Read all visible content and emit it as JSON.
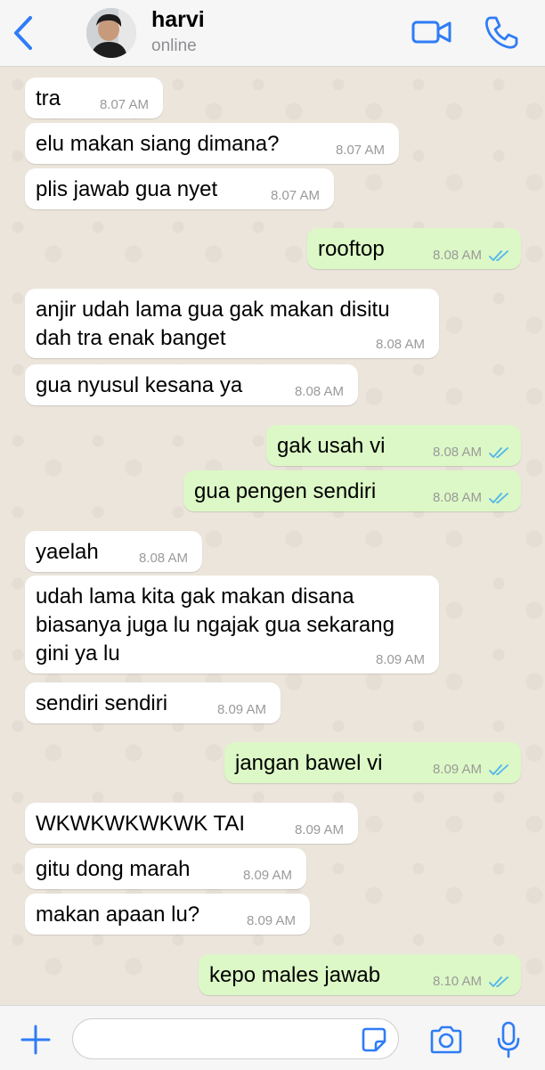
{
  "header": {
    "back_icon": "chevron-left-icon",
    "contact_name": "harvi",
    "contact_status": "online",
    "video_icon": "video-camera-icon",
    "call_icon": "phone-icon",
    "accent_color": "#2f7cf6"
  },
  "messages": [
    {
      "direction": "in",
      "text": "tra",
      "time": "8.07 AM"
    },
    {
      "direction": "in",
      "text": "elu makan siang dimana?",
      "time": "8.07 AM"
    },
    {
      "direction": "in",
      "text": "plis jawab gua nyet",
      "time": "8.07 AM"
    },
    {
      "direction": "out",
      "text": "rooftop",
      "time": "8.08 AM",
      "read": true
    },
    {
      "direction": "in",
      "text": "anjir udah lama gua gak makan disitu\ndah tra enak banget",
      "time": "8.08 AM"
    },
    {
      "direction": "in",
      "text": "gua nyusul kesana ya",
      "time": "8.08 AM"
    },
    {
      "direction": "out",
      "text": "gak usah vi",
      "time": "8.08 AM",
      "read": true
    },
    {
      "direction": "out",
      "text": "gua pengen sendiri",
      "time": "8.08 AM",
      "read": true
    },
    {
      "direction": "in",
      "text": "yaelah",
      "time": "8.08 AM"
    },
    {
      "direction": "in",
      "text": "udah lama kita gak makan disana\nbiasanya juga lu ngajak gua sekarang\ngini ya lu",
      "time": "8.09 AM"
    },
    {
      "direction": "in",
      "text": "sendiri sendiri",
      "time": "8.09 AM"
    },
    {
      "direction": "out",
      "text": "jangan bawel vi",
      "time": "8.09 AM",
      "read": true
    },
    {
      "direction": "in",
      "text": "WKWKWKWKWK TAI",
      "time": "8.09 AM"
    },
    {
      "direction": "in",
      "text": "gitu dong marah",
      "time": "8.09 AM"
    },
    {
      "direction": "in",
      "text": "makan apaan lu?",
      "time": "8.09 AM"
    },
    {
      "direction": "out",
      "text": "kepo males jawab",
      "time": "8.10 AM",
      "read": true
    }
  ],
  "composer": {
    "plus_icon": "plus-icon",
    "input_value": "",
    "input_placeholder": "",
    "sticker_icon": "sticker-icon",
    "camera_icon": "camera-icon",
    "mic_icon": "microphone-icon"
  },
  "colors": {
    "incoming_bubble": "#ffffff",
    "outgoing_bubble": "#dcf8c6",
    "read_ticks": "#4fb6ec",
    "chat_background": "#ebe5db"
  }
}
